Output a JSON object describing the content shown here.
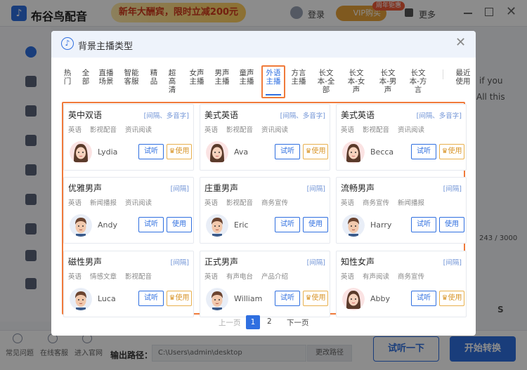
{
  "app": {
    "name": "布谷鸟配音",
    "promo": "新年大酬宾，限时立减200元",
    "login": "登录",
    "vip_label": "VIP购买",
    "vip_badge": "周年钜惠",
    "more": "更多"
  },
  "background": {
    "right_text_1": "if you",
    "right_text_2": "All this",
    "counter": "243 / 3000",
    "play_text": "S",
    "bottom_items": [
      "常见问题",
      "在线客服",
      "进入官网"
    ],
    "output_label": "输出路径：",
    "output_path": "C:\\Users\\admin\\desktop",
    "change_path": "更改路径",
    "listen_button": "试听一下",
    "convert_button": "开始转换"
  },
  "modal": {
    "title": "背景主播类型",
    "tabs": [
      {
        "label": "热门"
      },
      {
        "label": "全部"
      },
      {
        "label": "直播场景"
      },
      {
        "label": "智能客服"
      },
      {
        "label": "精品"
      },
      {
        "label": "超高清"
      },
      {
        "label": "女声主播"
      },
      {
        "label": "男声主播"
      },
      {
        "label": "童声主播"
      },
      {
        "label": "外语主播",
        "active": true
      },
      {
        "label": "方言主播"
      },
      {
        "label": "长文本-全部"
      },
      {
        "label": "长文本-女声"
      },
      {
        "label": "长文本-男声"
      },
      {
        "label": "长文本-方言"
      },
      {
        "label": "最近使用"
      }
    ],
    "cards": [
      {
        "title": "英中双语",
        "tagline": "[间隔、多音字]",
        "tags": [
          "英语",
          "影视配音",
          "资讯阅读"
        ],
        "voice": "Lydia",
        "listen": "试听",
        "use": "使用",
        "vip": true,
        "gender": "f"
      },
      {
        "title": "美式英语",
        "tagline": "[间隔、多音字]",
        "tags": [
          "英语",
          "影视配音",
          "资讯阅读"
        ],
        "voice": "Ava",
        "listen": "试听",
        "use": "使用",
        "vip": true,
        "gender": "f"
      },
      {
        "title": "美式英语",
        "tagline": "[间隔、多音字]",
        "tags": [
          "英语",
          "影视配音",
          "资讯阅读"
        ],
        "voice": "Becca",
        "listen": "试听",
        "use": "使用",
        "vip": true,
        "gender": "f"
      },
      {
        "title": "优雅男声",
        "tagline": "[间隔]",
        "tags": [
          "英语",
          "新闻播报",
          "资讯阅读"
        ],
        "voice": "Andy",
        "listen": "试听",
        "use": "使用",
        "vip": false,
        "gender": "m"
      },
      {
        "title": "庄重男声",
        "tagline": "[间隔]",
        "tags": [
          "英语",
          "影视配音",
          "商务宣传"
        ],
        "voice": "Eric",
        "listen": "试听",
        "use": "使用",
        "vip": false,
        "gender": "m"
      },
      {
        "title": "流畅男声",
        "tagline": "[间隔]",
        "tags": [
          "英语",
          "商务宣传",
          "新闻播报"
        ],
        "voice": "Harry",
        "listen": "试听",
        "use": "使用",
        "vip": false,
        "gender": "m"
      },
      {
        "title": "磁性男声",
        "tagline": "[间隔]",
        "tags": [
          "英语",
          "情感文章",
          "影视配音"
        ],
        "voice": "Luca",
        "listen": "试听",
        "use": "使用",
        "vip": true,
        "gender": "m"
      },
      {
        "title": "正式男声",
        "tagline": "[间隔]",
        "tags": [
          "英语",
          "有声电台",
          "产品介绍"
        ],
        "voice": "William",
        "listen": "试听",
        "use": "使用",
        "vip": true,
        "gender": "m"
      },
      {
        "title": "知性女声",
        "tagline": "[间隔]",
        "tags": [
          "英语",
          "有声阅读",
          "商务宣传"
        ],
        "voice": "Abby",
        "listen": "试听",
        "use": "使用",
        "vip": true,
        "gender": "f"
      }
    ],
    "pager": {
      "prev": "上一页",
      "page1": "1",
      "page2": "2",
      "next": "下一页"
    }
  }
}
